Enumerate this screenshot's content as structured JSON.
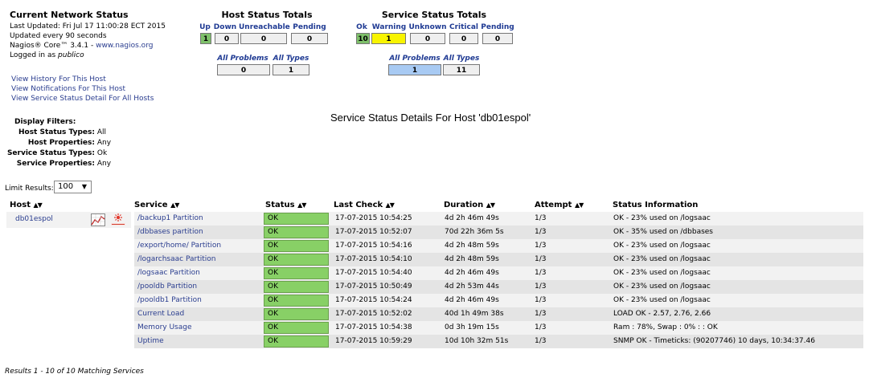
{
  "info": {
    "title": "Current Network Status",
    "last_updated": "Last Updated: Fri Jul 17 11:00:28 ECT 2015",
    "update_interval": "Updated every 90 seconds",
    "version_prefix": "Nagios® Core™ 3.4.1 - ",
    "version_link": "www.nagios.org",
    "logged_prefix": "Logged in as ",
    "logged_user": "publico"
  },
  "links": {
    "history": "View History For This Host",
    "notifications": "View Notifications For This Host",
    "service_detail": "View Service Status Detail For All Hosts"
  },
  "host_totals": {
    "title": "Host Status Totals",
    "headers": [
      "Up",
      "Down",
      "Unreachable",
      "Pending"
    ],
    "values": [
      "1",
      "0",
      "0",
      "0"
    ],
    "sub_headers": [
      "All Problems",
      "All Types"
    ],
    "sub_values": [
      "0",
      "1"
    ]
  },
  "service_totals": {
    "title": "Service Status Totals",
    "headers": [
      "Ok",
      "Warning",
      "Unknown",
      "Critical",
      "Pending"
    ],
    "values": [
      "10",
      "1",
      "0",
      "0",
      "0"
    ],
    "sub_headers": [
      "All Problems",
      "All Types"
    ],
    "sub_values": [
      "1",
      "11"
    ]
  },
  "filters": {
    "title": "Display Filters:",
    "items": [
      {
        "label": "Host Status Types:",
        "value": "All"
      },
      {
        "label": "Host Properties:",
        "value": "Any"
      },
      {
        "label": "Service Status Types:",
        "value": "Ok"
      },
      {
        "label": "Service Properties:",
        "value": "Any"
      }
    ]
  },
  "page_title": "Service Status Details For Host 'db01espol'",
  "limit": {
    "label": "Limit Results:",
    "value": "100"
  },
  "table": {
    "headers": [
      "Host",
      "Service",
      "Status",
      "Last Check",
      "Duration",
      "Attempt",
      "Status Information"
    ],
    "host": "db01espol",
    "rows": [
      {
        "service": "/backup1 Partition",
        "status": "OK",
        "last_check": "17-07-2015 10:54:25",
        "duration": "4d 2h 46m 49s",
        "attempt": "1/3",
        "info": "OK - 23% used on /logsaac"
      },
      {
        "service": "/dbbases partition",
        "status": "OK",
        "last_check": "17-07-2015 10:52:07",
        "duration": "70d 22h 36m 5s",
        "attempt": "1/3",
        "info": "OK - 35% used on /dbbases"
      },
      {
        "service": "/export/home/ Partition",
        "status": "OK",
        "last_check": "17-07-2015 10:54:16",
        "duration": "4d 2h 48m 59s",
        "attempt": "1/3",
        "info": "OK - 23% used on /logsaac"
      },
      {
        "service": "/logarchsaac Partition",
        "status": "OK",
        "last_check": "17-07-2015 10:54:10",
        "duration": "4d 2h 48m 59s",
        "attempt": "1/3",
        "info": "OK - 23% used on /logsaac"
      },
      {
        "service": "/logsaac Partition",
        "status": "OK",
        "last_check": "17-07-2015 10:54:40",
        "duration": "4d 2h 46m 49s",
        "attempt": "1/3",
        "info": "OK - 23% used on /logsaac"
      },
      {
        "service": "/pooldb Partition",
        "status": "OK",
        "last_check": "17-07-2015 10:50:49",
        "duration": "4d 2h 53m 44s",
        "attempt": "1/3",
        "info": "OK - 23% used on /logsaac"
      },
      {
        "service": "/pooldb1 Partition",
        "status": "OK",
        "last_check": "17-07-2015 10:54:24",
        "duration": "4d 2h 46m 49s",
        "attempt": "1/3",
        "info": "OK - 23% used on /logsaac"
      },
      {
        "service": "Current Load",
        "status": "OK",
        "last_check": "17-07-2015 10:52:02",
        "duration": "40d 1h 49m 38s",
        "attempt": "1/3",
        "info": "LOAD OK - 2.57, 2.76, 2.66"
      },
      {
        "service": "Memory Usage",
        "status": "OK",
        "last_check": "17-07-2015 10:54:38",
        "duration": "0d 3h 19m 15s",
        "attempt": "1/3",
        "info": "Ram : 78%, Swap : 0% : : OK"
      },
      {
        "service": "Uptime",
        "status": "OK",
        "last_check": "17-07-2015 10:59:29",
        "duration": "10d 10h 32m 51s",
        "attempt": "1/3",
        "info": "SNMP OK - Timeticks: (90207746) 10 days, 10:34:37.46"
      }
    ]
  },
  "footer": "Results 1 - 10 of 10 Matching Services",
  "colors": {
    "ok": "#88d066",
    "warning": "#f8f400",
    "link": "#2a3d8f",
    "up": "#7ec06a",
    "problems": "#a8caf3"
  },
  "icons": [
    "graph-icon",
    "solaris-icon",
    "sort-arrows-icon"
  ]
}
